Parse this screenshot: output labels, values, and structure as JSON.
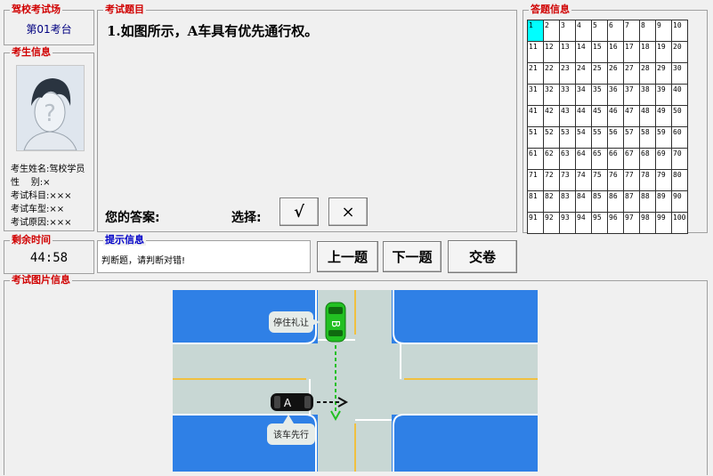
{
  "exam_room": {
    "legend": "驾校考试场",
    "name": "第01考台"
  },
  "candidate": {
    "legend": "考生信息",
    "rows": [
      {
        "label": "考生姓名:",
        "value": "驾校学员"
      },
      {
        "label": "性    别:",
        "value": "×"
      },
      {
        "label": "考试科目:",
        "value": "×××"
      },
      {
        "label": "考试车型:",
        "value": "××"
      },
      {
        "label": "考试原因:",
        "value": "×××"
      }
    ]
  },
  "timer": {
    "legend": "剩余时间",
    "value": "44:58"
  },
  "question": {
    "legend": "考试题目",
    "text": "1.如图所示，A车具有优先通行权。",
    "answer_label": "您的答案:",
    "choose_label": "选择:",
    "option_true": "√",
    "option_false": "×"
  },
  "answer_sheet": {
    "legend": "答题信息",
    "numbers": [
      "1",
      "2",
      "3",
      "4",
      "5",
      "6",
      "7",
      "8",
      "9",
      "10",
      "11",
      "12",
      "13",
      "14",
      "15",
      "16",
      "17",
      "18",
      "19",
      "20",
      "21",
      "22",
      "23",
      "24",
      "25",
      "26",
      "27",
      "28",
      "29",
      "30",
      "31",
      "32",
      "33",
      "34",
      "35",
      "36",
      "37",
      "38",
      "39",
      "40",
      "41",
      "42",
      "43",
      "44",
      "45",
      "46",
      "47",
      "48",
      "49",
      "50",
      "51",
      "52",
      "53",
      "54",
      "55",
      "56",
      "57",
      "58",
      "59",
      "60",
      "61",
      "62",
      "63",
      "64",
      "65",
      "66",
      "67",
      "68",
      "69",
      "70",
      "71",
      "72",
      "73",
      "74",
      "75",
      "76",
      "77",
      "78",
      "79",
      "80",
      "81",
      "82",
      "83",
      "84",
      "85",
      "86",
      "87",
      "88",
      "89",
      "90",
      "91",
      "92",
      "93",
      "94",
      "95",
      "96",
      "97",
      "98",
      "99",
      "100"
    ],
    "current": 1
  },
  "hint": {
    "legend": "提示信息",
    "text": "判断题，请判断对错!"
  },
  "nav": {
    "prev": "上一题",
    "next": "下一题",
    "submit": "交卷"
  },
  "image_panel": {
    "legend": "考试图片信息",
    "bubble_b": "停住礼让",
    "bubble_a": "该车先行",
    "car_a": "A",
    "car_b": "B"
  },
  "colors": {
    "water": "#2f80e6",
    "road": "#c8d7d4",
    "lane_yellow": "#f0c040",
    "car_b": "#22c022",
    "car_a": "#111111",
    "arrow_b": "#22c022",
    "current_cell": "#00ffff"
  }
}
